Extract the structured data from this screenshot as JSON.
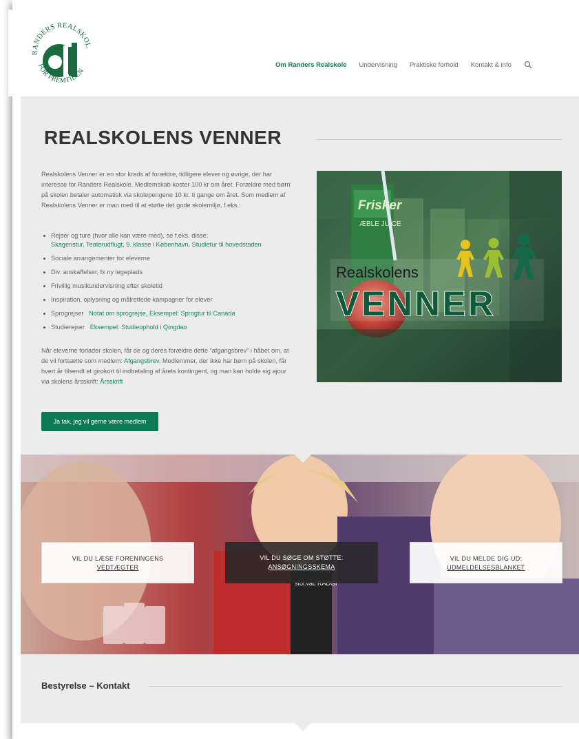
{
  "header": {
    "logo_text": "RANDERS REALSKOLE FOR FREMTIDEN",
    "nav": [
      {
        "label": "Om Randers Realskole"
      },
      {
        "label": "Undervisning"
      },
      {
        "label": "Praktiske forhold"
      },
      {
        "label": "Kontakt & info"
      }
    ],
    "search_icon": "search-icon"
  },
  "main": {
    "title": "REALSKOLENS VENNER",
    "intro": "Realskolens Venner er en stor kreds af forældre, tidligere elever og øvrige, der har interesse for Randers Realskole. Medlemskab koster 100 kr om året. Forældre med børn på skolen betaler automatisk via skolepengene 10 kr. ti gange om året. Som medlem af Realskolens Venner er man med til at støtte det gode skolemiljø, f.eks.:",
    "bullets": [
      {
        "text": "Rejser og ture (hvor alle kan være med), se f.eks. disse:",
        "link": "Skagenstur, Teaterudflugt, 9. klasse i København, Studietur til hovedstaden",
        "newline": true
      },
      {
        "text": "Sociale arrangementer for eleverne",
        "link": ""
      },
      {
        "text": "Div. anskaffelser, fx ny legeplads",
        "link": ""
      },
      {
        "text": "Frivillig musikundervisning efter skoletid",
        "link": ""
      },
      {
        "text": "Inspiration, oplysning og målrettede kampagner for elever",
        "link": ""
      },
      {
        "text": "Sprogrejser",
        "link": "Notat om sprogrejse, Eksempel: Sprogtur til Canada"
      },
      {
        "text": "Studierejser",
        "link": "Eksempel: Studieophold i Qingdao"
      }
    ],
    "outro_1": "Når eleverne forlader skolen, får de og deres forældre dette “afgangsbrev” i håbet om, at de vil fortsætte som medlem: ",
    "outro_link1": "Afgangsbrev.",
    "outro_2": "  Medlemmer, der ikke har børn på skolen, får hvert år tilsendt et girokort til indbetaling af årets kontingent, og man kan holde sig ajour via skolens årsskrift: ",
    "outro_link2": "Årsskrift",
    "join_button": "Ja tak, jeg vil gerne være medlem",
    "hero_image": {
      "text_top": "Realskolens",
      "text_bottom": "VENNER",
      "carton_brand": "Frisker",
      "carton_label": "ÆBLE JUICE"
    }
  },
  "cards": [
    {
      "question": "VIL DU LÆSE FORENINGENS",
      "link": "VEDTÆGTER"
    },
    {
      "question": "VIL DU SØGE OM STØTTE:",
      "link": "ANSØGNINGSSKEMA"
    },
    {
      "question": "VIL DU MELDE DIG UD:",
      "link": "UDMELDELSESBLANKET"
    }
  ],
  "photo_band": {
    "shirt_text": "stol.vac\nRADGIV"
  },
  "bottom": {
    "section_title": "Bestyrelse – Kontakt"
  },
  "colors": {
    "accent": "#0b7a55",
    "link": "#128a60",
    "band": "#ececec"
  }
}
